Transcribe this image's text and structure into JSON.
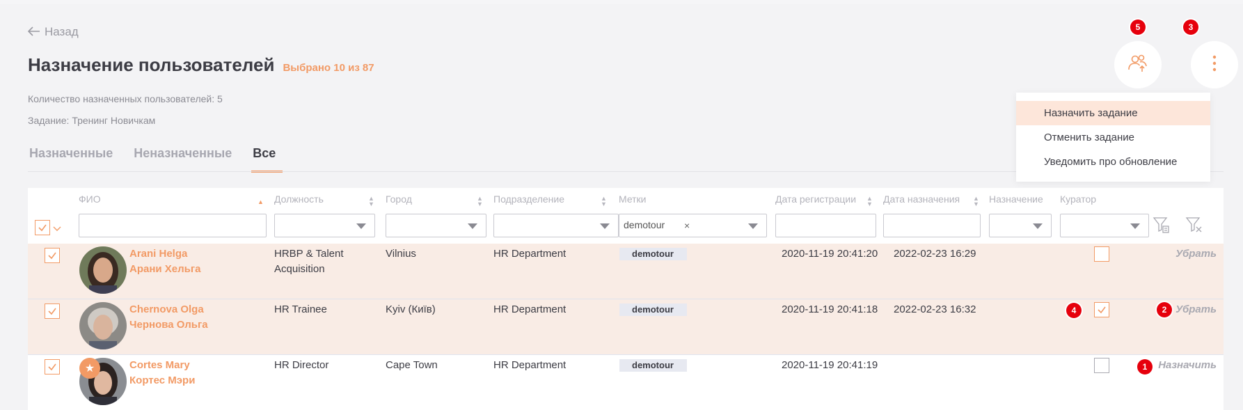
{
  "header": {
    "back_label": "Назад",
    "title": "Назначение пользователей",
    "selected": "Выбрано 10 из 87",
    "assigned_count": "Количество назначенных пользователей: 5",
    "task": "Задание: Тренинг Новичкам"
  },
  "tabs": [
    {
      "label": "Назначенные",
      "active": false
    },
    {
      "label": "Неназначенные",
      "active": false
    },
    {
      "label": "Все",
      "active": true
    }
  ],
  "actions": {
    "assign_users_icon": "user-group-upload-icon",
    "more_icon": "vertical-dots-icon",
    "markers": [
      "5",
      "3",
      "4",
      "2",
      "1"
    ]
  },
  "menu": {
    "items": [
      "Назначить задание",
      "Отменить задание",
      "Уведомить про обновление"
    ],
    "highlighted_index": 0
  },
  "table": {
    "columns": [
      "ФИО",
      "Должность",
      "Город",
      "Подразделение",
      "Метки",
      "Дата регистрации",
      "Дата назначения",
      "Назначение",
      "Куратор"
    ],
    "filters": {
      "tags_value": "demotour",
      "tags_remove": "×"
    },
    "rows": [
      {
        "name_lat": "Arani Helga",
        "name_cyr": "Арани Хельга",
        "position_line1": "HRBP & Talent",
        "position_line2": "Acquisition",
        "city": "Vilnius",
        "department": "HR Department",
        "tag": "demotour",
        "registered": "2020-11-19 20:41:20",
        "assigned": "2022-02-23 16:29",
        "curator": false,
        "selected": true,
        "action": "Убрать"
      },
      {
        "name_lat": "Chernova Olga",
        "name_cyr": "Чернова Ольга",
        "position_line1": "HR Trainee",
        "position_line2": "",
        "city": "Kyiv (Київ)",
        "department": "HR Department",
        "tag": "demotour",
        "registered": "2020-11-19 20:41:18",
        "assigned": "2022-02-23 16:32",
        "curator": true,
        "selected": true,
        "action": "Убрать"
      },
      {
        "name_lat": "Cortes Mary",
        "name_cyr": "Кортес Мэри",
        "position_line1": "HR Director",
        "position_line2": "",
        "city": "Cape Town",
        "department": "HR Department",
        "tag": "demotour",
        "registered": "2020-11-19 20:41:19",
        "assigned": "",
        "curator": false,
        "selected": true,
        "action": "Назначить"
      }
    ]
  },
  "colors": {
    "accent": "#f29a65",
    "selected_row": "#f9ece5",
    "marker": "#e6000c"
  }
}
